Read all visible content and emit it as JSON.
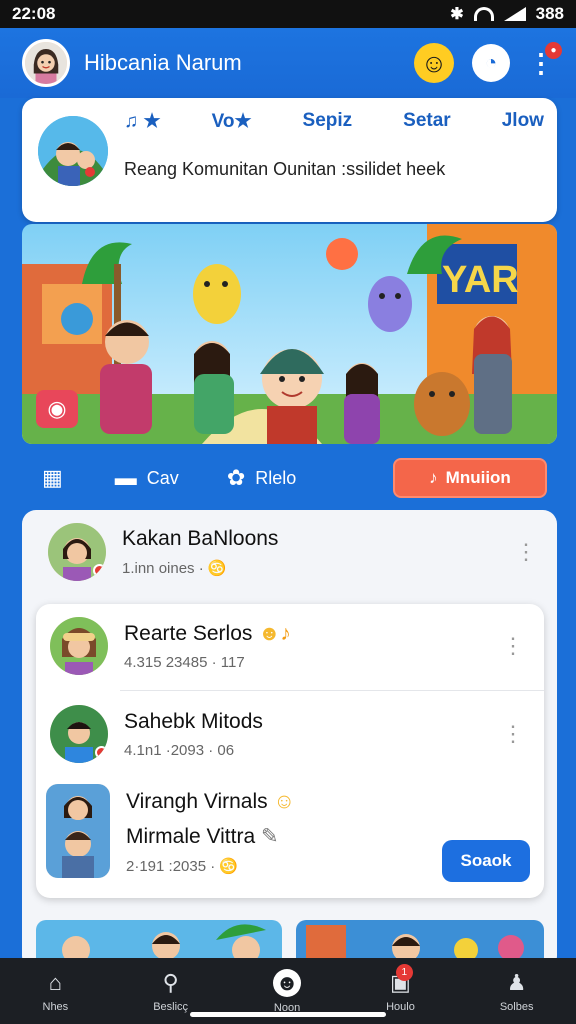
{
  "status_bar": {
    "time": "22:08",
    "battery": "388"
  },
  "app_bar": {
    "title": "Hibcania Narum"
  },
  "group_card": {
    "tabs": [
      {
        "label": "Vo"
      },
      {
        "label": "Sepiz"
      },
      {
        "label": "Setar"
      },
      {
        "label": "Jlow"
      }
    ],
    "description": "Reang Komunitan Ounitan :ssilidet heek"
  },
  "actions": {
    "chat_label": "Cav",
    "people_label": "Rlelo",
    "primary_label": "Mnuiion"
  },
  "feed": {
    "top_item": {
      "name": "Kakan BaNloons",
      "meta": "1.inn oines ·"
    },
    "items": [
      {
        "name": "Rearte Serlos",
        "meta": "4.315 23485 · 117"
      },
      {
        "name": "Sahebk Mitods",
        "meta": "4.1n1 ·2093 · 06"
      },
      {
        "name": "Virangh Virnals",
        "subtitle": "Mirmale Vittra",
        "meta": "2·191 :2035 ·"
      }
    ],
    "follow_label": "Soaok"
  },
  "bottom_nav": [
    {
      "label": "Nhes",
      "icon": "home-icon"
    },
    {
      "label": "Beslicç",
      "icon": "search-icon"
    },
    {
      "label": "Noon",
      "icon": "smile-icon"
    },
    {
      "label": "Houlo",
      "icon": "inbox-icon",
      "badge": "1"
    },
    {
      "label": "Solbes",
      "icon": "profile-icon"
    }
  ],
  "colors": {
    "brand": "#1b6fd8",
    "accent": "#f4664a",
    "button": "#1d6fe0"
  }
}
